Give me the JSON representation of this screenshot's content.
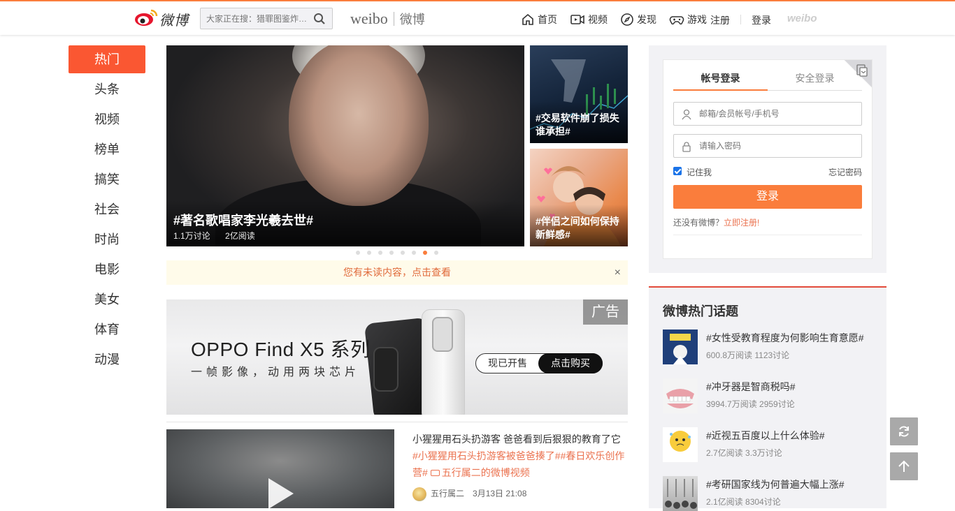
{
  "header": {
    "logo_text": "微博",
    "search_placeholder": "大家正在搜：猎罪图鉴炸…",
    "brand_en": "weibo",
    "brand_cn": "微博",
    "nav": [
      {
        "label": "首页",
        "icon": "home-icon"
      },
      {
        "label": "视频",
        "icon": "video-icon"
      },
      {
        "label": "发现",
        "icon": "compass-icon"
      },
      {
        "label": "游戏",
        "icon": "gamepad-icon"
      }
    ],
    "register": "注册",
    "login": "登录",
    "weibo_mark": "weibo"
  },
  "sidebar": {
    "items": [
      "热门",
      "头条",
      "视频",
      "榜单",
      "搞笑",
      "社会",
      "时尚",
      "电影",
      "美女",
      "体育",
      "动漫"
    ],
    "active_index": 0
  },
  "carousel": {
    "main": {
      "title": "#著名歌唱家李光羲去世#",
      "discussions": "1.1万讨论",
      "reads": "2亿阅读"
    },
    "side": [
      {
        "title": "#交易软件崩了损失谁承担#"
      },
      {
        "title": "#伴侣之间如何保持新鲜感#"
      }
    ],
    "dot_count": 8,
    "active_dot": 6
  },
  "notice": {
    "text": "您有未读内容，点击查看",
    "close": "×"
  },
  "ad": {
    "badge": "广告",
    "headline": "OPPO Find X5 系列",
    "sub": "一帧影像，动用两块芯片",
    "btn_sale": "现已开售",
    "btn_buy": "点击购买"
  },
  "feed": {
    "title": "小猩猩用石头扔游客 爸爸看到后狠狠的教育了它",
    "tags": "#小猩猩用石头扔游客被爸爸揍了##春日欢乐创作营#",
    "video_link": "五行属二的微博视频",
    "author": "五行属二",
    "time": "3月13日 21:08"
  },
  "login": {
    "tab_account": "帐号登录",
    "tab_secure": "安全登录",
    "user_placeholder": "邮箱/会员帐号/手机号",
    "pass_placeholder": "请输入密码",
    "remember": "记住我",
    "forgot": "忘记密码",
    "submit": "登录",
    "no_account": "还没有微博？",
    "signup": "立即注册!"
  },
  "topics": {
    "heading": "微博热门话题",
    "items": [
      {
        "title": "#女性受教育程度为何影响生育意愿#",
        "meta": "600.8万阅读 1123讨论"
      },
      {
        "title": "#冲牙器是智商税吗#",
        "meta": "3994.7万阅读 2959讨论"
      },
      {
        "title": "#近视五百度以上什么体验#",
        "meta": "2.7亿阅读 3.3万讨论"
      },
      {
        "title": "#考研国家线为何普遍大幅上涨#",
        "meta": "2.1亿阅读 8304讨论"
      }
    ]
  },
  "colors": {
    "accent": "#fa7d3c",
    "active_tab": "#fa5732",
    "link": "#eb7350"
  }
}
